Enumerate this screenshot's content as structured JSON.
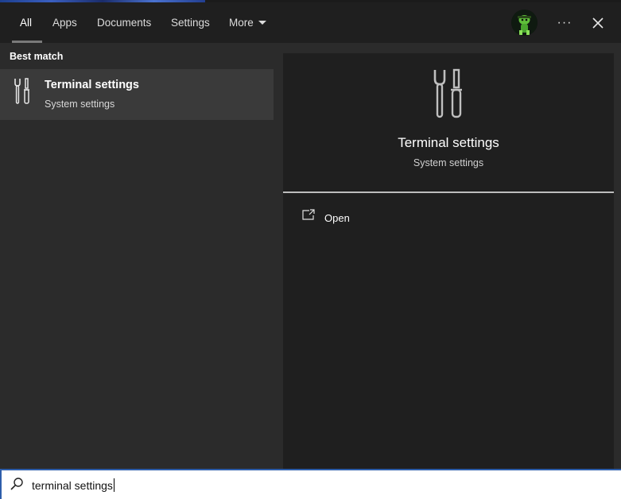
{
  "tabs": [
    {
      "label": "All"
    },
    {
      "label": "Apps"
    },
    {
      "label": "Documents"
    },
    {
      "label": "Settings"
    },
    {
      "label": "More"
    }
  ],
  "header": {
    "avatar": "user-avatar",
    "more_icon": "ellipsis-icon",
    "close_icon": "close-icon"
  },
  "results": {
    "section_label": "Best match",
    "items": [
      {
        "title": "Terminal settings",
        "subtitle": "System settings",
        "icon": "tools-icon"
      }
    ]
  },
  "detail": {
    "title": "Terminal settings",
    "subtitle": "System settings",
    "icon": "tools-icon",
    "actions": [
      {
        "label": "Open",
        "icon": "open-external-icon"
      }
    ]
  },
  "search": {
    "value": "terminal settings",
    "icon": "search-icon"
  },
  "colors": {
    "background": "#2b2b2b",
    "topbar": "#1f1f1f",
    "selected_item": "#3a3a3a",
    "detail_card": "#1f1f1f",
    "search_border": "#2e5eaa"
  }
}
